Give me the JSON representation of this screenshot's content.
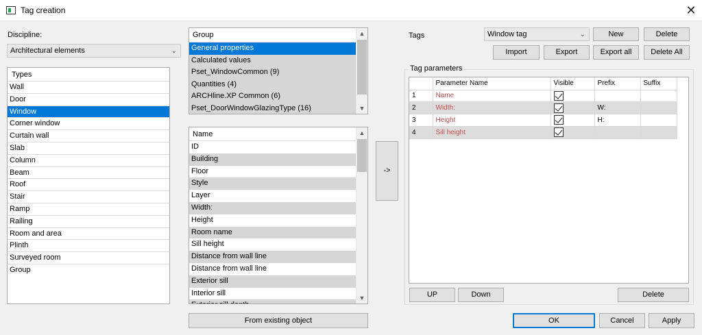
{
  "window": {
    "title": "Tag creation",
    "close_glyph": "✕"
  },
  "discipline": {
    "label": "Discipline:",
    "value": "Architectural elements"
  },
  "types": {
    "header": "Types",
    "items": [
      "Wall",
      "Door",
      "Window",
      "Corner window",
      "Curtain wall",
      "Slab",
      "Column",
      "Beam",
      "Roof",
      "Stair",
      "Ramp",
      "Railing",
      "Room and area",
      "Plinth",
      "Surveyed room",
      "Group"
    ],
    "selected": "Window"
  },
  "group_list": {
    "header": "Group",
    "items": [
      "General properties",
      "Calculated values",
      "Pset_WindowCommon (9)",
      "Quantities (4)",
      "ARCHline.XP Common (6)",
      "Pset_DoorWindowGlazingType (16)"
    ],
    "selected": "General properties"
  },
  "name_list": {
    "header": "Name",
    "items": [
      "ID",
      "Building",
      "Floor",
      "Style",
      "Layer",
      "Width:",
      "Height",
      "Room name",
      "Sill height",
      "Distance from wall line",
      "Distance from wall line",
      "Exterior sill",
      "Interior sill",
      "Exterior sill depth"
    ]
  },
  "transfer_button": "->",
  "from_existing_button": "From existing object",
  "tags": {
    "label": "Tags",
    "selected": "Window tag",
    "buttons": {
      "new": "New",
      "delete": "Delete",
      "import": "Import",
      "export": "Export",
      "export_all": "Export all",
      "delete_all": "Delete All"
    }
  },
  "tag_parameters": {
    "label": "Tag parameters",
    "columns": [
      "",
      "Parameter Name",
      "Visible",
      "Prefix",
      "Suffix"
    ],
    "rows": [
      {
        "index": "1",
        "name": "Name",
        "visible": true,
        "prefix": "",
        "suffix": ""
      },
      {
        "index": "2",
        "name": "Width:",
        "visible": true,
        "prefix": "W:",
        "suffix": ""
      },
      {
        "index": "3",
        "name": "Height",
        "visible": true,
        "prefix": "H:",
        "suffix": ""
      },
      {
        "index": "4",
        "name": "Sill height",
        "visible": true,
        "prefix": "",
        "suffix": ""
      }
    ],
    "buttons": {
      "up": "UP",
      "down": "Down",
      "delete": "Delete"
    }
  },
  "dialog_buttons": {
    "ok": "OK",
    "cancel": "Cancel",
    "apply": "Apply"
  },
  "icons": {
    "window-icon": "app",
    "combo-arrow": "chevron-down",
    "scroll-up": "▲",
    "scroll-down": "▼"
  },
  "colors": {
    "selection": "#0078d7",
    "param_name": "#c0504d"
  }
}
